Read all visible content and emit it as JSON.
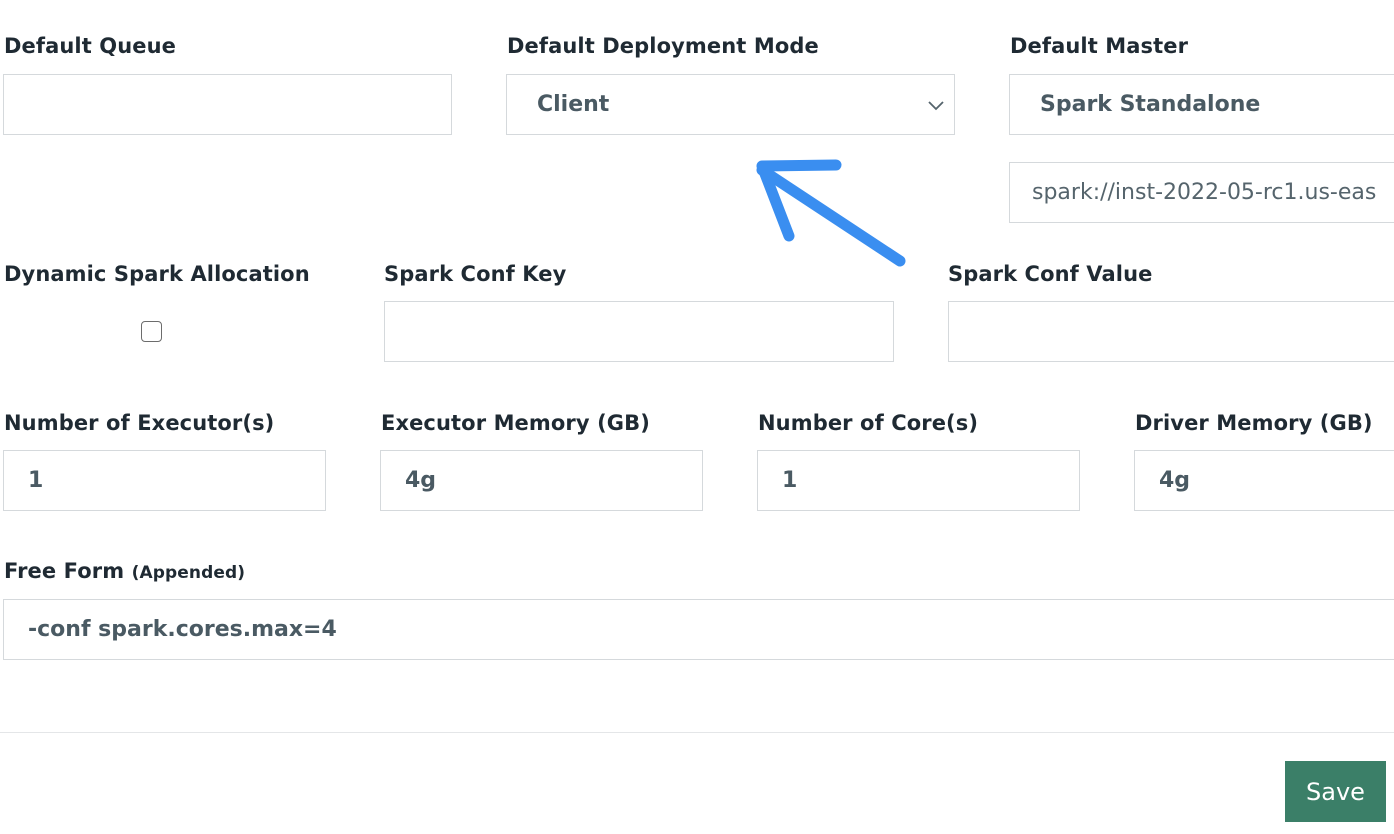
{
  "row1": {
    "default_queue": {
      "label": "Default Queue",
      "value": ""
    },
    "deployment_mode": {
      "label": "Default Deployment Mode",
      "value": "Client"
    },
    "default_master": {
      "label": "Default Master",
      "value": "Spark Standalone",
      "url_value": "spark://inst-2022-05-rc1.us-eas"
    }
  },
  "row2": {
    "dynamic_allocation": {
      "label": "Dynamic Spark Allocation",
      "checked": false
    },
    "conf_key": {
      "label": "Spark Conf Key",
      "value": ""
    },
    "conf_value": {
      "label": "Spark Conf Value",
      "value": ""
    }
  },
  "row3": {
    "executors": {
      "label": "Number of Executor(s)",
      "value": "1"
    },
    "executor_memory": {
      "label": "Executor Memory (GB)",
      "value": "4g"
    },
    "cores": {
      "label": "Number of Core(s)",
      "value": "1"
    },
    "driver_memory": {
      "label": "Driver Memory (GB)",
      "value": "4g"
    }
  },
  "free_form": {
    "label": "Free Form",
    "sub_label": "(Appended)",
    "value": "-conf spark.cores.max=4"
  },
  "footer": {
    "save_label": "Save"
  },
  "colors": {
    "annotation_arrow": "#3a8ef0",
    "save_button": "#3b7f68"
  },
  "icons": {
    "select_chevron": "chevron-down-icon",
    "annotation": "arrow-icon"
  }
}
